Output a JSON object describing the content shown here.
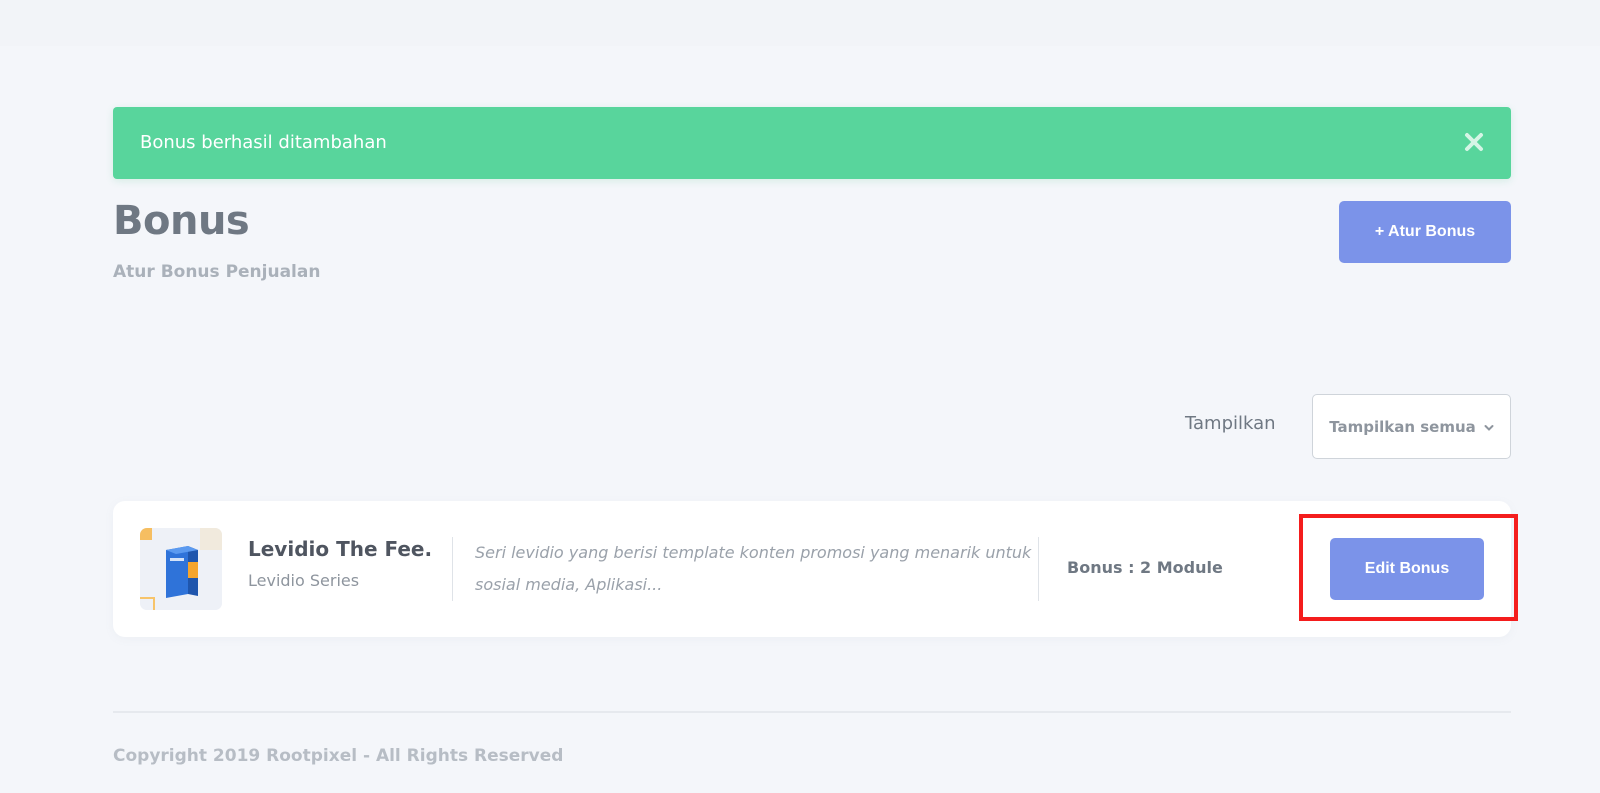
{
  "alert": {
    "message": "Bonus berhasil ditambahan",
    "close_icon": "close-icon",
    "color": "#58d59c"
  },
  "header": {
    "title": "Bonus",
    "subtitle": "Atur Bonus Penjualan",
    "add_button_label": "+ Atur Bonus"
  },
  "filter": {
    "label": "Tampilkan",
    "selected": "Tampilkan semua",
    "icon": "chevron-down-icon"
  },
  "items": [
    {
      "name": "Levidio The Fee...",
      "series": "Levidio Series",
      "description": "Seri levidio yang berisi template konten promosi yang menarik untuk sosial media, Aplikasi...",
      "bonus": "Bonus : 2 Module",
      "edit_label": "Edit Bonus",
      "thumbnail": "product-box-image"
    }
  ],
  "footer": {
    "copyright": "Copyright 2019 Rootpixel - All Rights Reserved"
  },
  "colors": {
    "accent": "#7b93e9",
    "success": "#58d59c",
    "highlight": "#f41d1d",
    "background": "#f4f6fa"
  }
}
